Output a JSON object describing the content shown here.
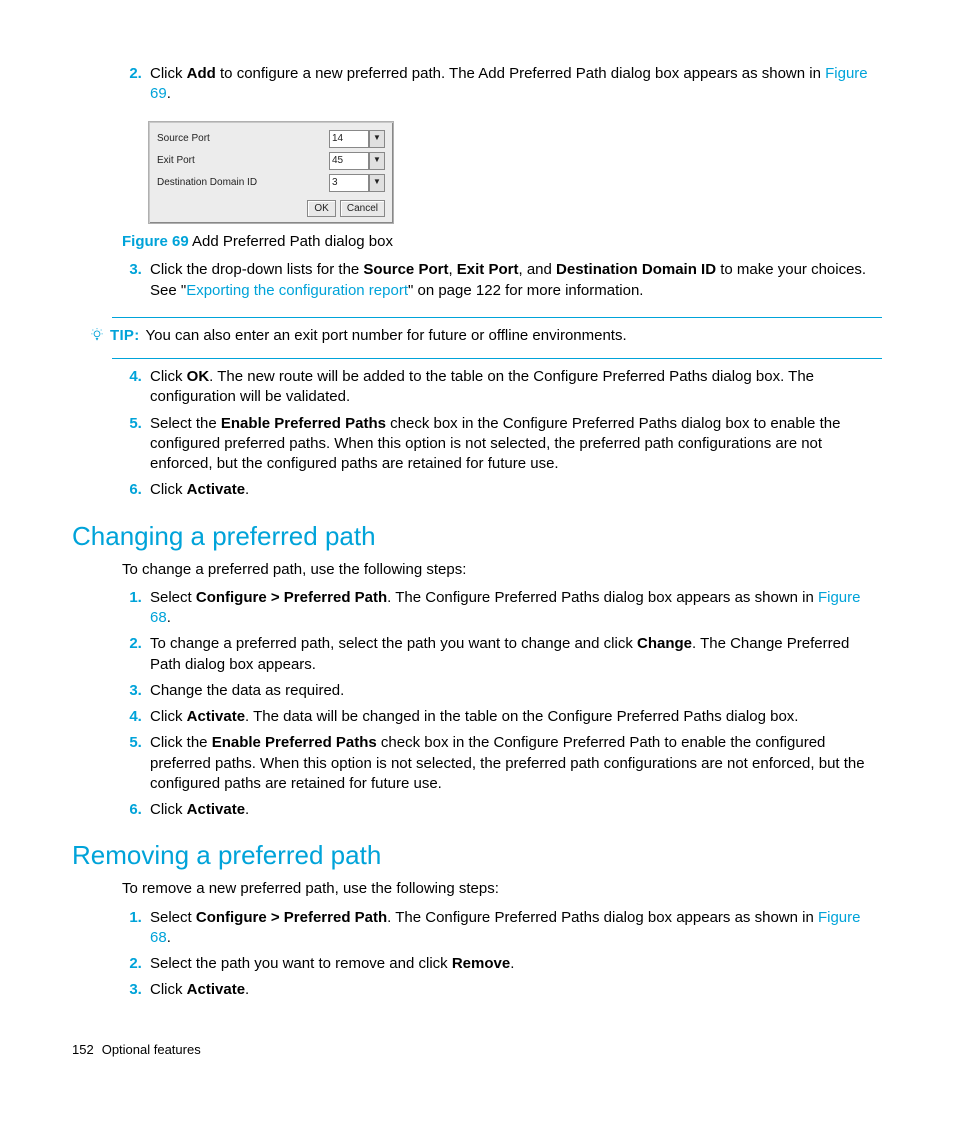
{
  "step2": {
    "pre": "Click ",
    "b1": "Add",
    "mid": " to configure a new preferred path. The Add Preferred Path dialog box appears as shown in ",
    "link": "Figure 69",
    "post": "."
  },
  "dialog": {
    "row1_label": "Source Port",
    "row1_value": "14",
    "row2_label": "Exit Port",
    "row2_value": "45",
    "row3_label": "Destination Domain ID",
    "row3_value": "3",
    "ok": "OK",
    "cancel": "Cancel"
  },
  "figcap": {
    "strong": "Figure 69",
    "rest": " Add Preferred Path dialog box"
  },
  "step3": {
    "pre": "Click the drop-down lists for the ",
    "b1": "Source Port",
    "c1": ", ",
    "b2": "Exit Port",
    "c2": ", and ",
    "b3": "Destination Domain ID",
    "mid": " to make your choices. See \"",
    "link": "Exporting the configuration report",
    "post": "\" on page 122 for more information."
  },
  "tip": {
    "label": "TIP:",
    "text": "You can also enter an exit port number for future or offline environments."
  },
  "step4": {
    "pre": "Click ",
    "b1": "OK",
    "post": ". The new route will be added to the table on the Configure Preferred Paths dialog box. The configuration will be validated."
  },
  "step5": {
    "pre": "Select the ",
    "b1": "Enable Preferred Paths",
    "post": " check box in the Configure Preferred Paths dialog box to enable the configured preferred paths. When this option is not selected, the preferred path configurations are not enforced, but the configured paths are retained for future use."
  },
  "step6": {
    "pre": "Click ",
    "b1": "Activate",
    "post": "."
  },
  "h_changing": "Changing a preferred path",
  "ch_intro": "To change a preferred path, use the following steps:",
  "ch1": {
    "pre": "Select ",
    "b1": "Configure > Preferred Path",
    "mid": ". The Configure Preferred Paths dialog box appears as shown in ",
    "link": "Figure 68",
    "post": "."
  },
  "ch2": {
    "pre": "To change a preferred path, select the path you want to change and click ",
    "b1": "Change",
    "post": ". The Change Preferred Path dialog box appears."
  },
  "ch3": {
    "text": "Change the data as required."
  },
  "ch4": {
    "pre": "Click ",
    "b1": "Activate",
    "post": ". The data will be changed in the table on the Configure Preferred Paths dialog box."
  },
  "ch5": {
    "pre": "Click the ",
    "b1": "Enable Preferred Paths",
    "post": " check box in the Configure Preferred Path to enable the configured preferred paths. When this option is not selected, the preferred path configurations are not enforced, but the configured paths are retained for future use."
  },
  "ch6": {
    "pre": "Click ",
    "b1": "Activate",
    "post": "."
  },
  "h_removing": "Removing a preferred path",
  "rm_intro": "To remove a new preferred path, use the following steps:",
  "rm1": {
    "pre": "Select ",
    "b1": "Configure > Preferred Path",
    "mid": ". The Configure Preferred Paths dialog box appears as shown in ",
    "link": "Figure 68",
    "post": "."
  },
  "rm2": {
    "pre": "Select the path you want to remove and click ",
    "b1": "Remove",
    "post": "."
  },
  "rm3": {
    "pre": "Click ",
    "b1": "Activate",
    "post": "."
  },
  "footer": {
    "page": "152",
    "section": "Optional features"
  }
}
